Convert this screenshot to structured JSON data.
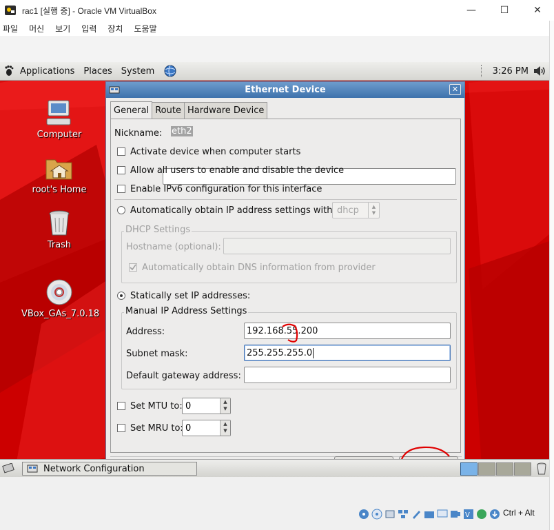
{
  "host_window": {
    "title": "rac1 [실행 중] - Oracle VM VirtualBox",
    "minimize_glyph": "—",
    "maximize_glyph": "☐",
    "close_glyph": "✕",
    "menu": [
      "파일",
      "머신",
      "보기",
      "입력",
      "장치",
      "도움말"
    ]
  },
  "gnome_panel": {
    "menus": [
      "Applications",
      "Places",
      "System"
    ],
    "clock": "3:26 PM"
  },
  "desktop_icons": [
    {
      "label": "Computer",
      "icon": "computer-icon"
    },
    {
      "label": "root's Home",
      "icon": "home-folder-icon"
    },
    {
      "label": "Trash",
      "icon": "trash-icon"
    },
    {
      "label": "VBox_GAs_7.0.18",
      "icon": "cd-icon"
    }
  ],
  "dialog": {
    "title": "Ethernet Device",
    "close_glyph": "✕",
    "tabs": [
      "General",
      "Route",
      "Hardware Device"
    ],
    "active_tab": "General",
    "nickname_label": "Nickname:",
    "nickname_value": "eth2",
    "activate_on_start": "Activate device when computer starts",
    "allow_all_users": "Allow all users to enable and disable the device",
    "enable_ipv6": "Enable IPv6 configuration for this interface",
    "auto_obtain_label": "Automatically obtain IP address settings with:",
    "auto_obtain_method": "dhcp",
    "dhcp_settings_label": "DHCP Settings",
    "hostname_label": "Hostname (optional):",
    "auto_dns_label": "Automatically obtain DNS information from provider",
    "static_label": "Statically set IP addresses:",
    "manual_label": "Manual IP Address Settings",
    "address_label": "Address:",
    "address_value": "192.168.55.200",
    "subnet_label": "Subnet mask:",
    "subnet_value": "255.255.255.0",
    "gateway_label": "Default gateway address:",
    "gateway_value": "",
    "mtu_label": "Set MTU to:",
    "mtu_value": "0",
    "mru_label": "Set MRU to:",
    "mru_value": "0"
  },
  "taskbar": {
    "task_label": "Network Configuration"
  },
  "host_status": {
    "hostkey_label": "Ctrl + Alt"
  },
  "colors": {
    "desktop_red": "#d40000",
    "dialog_title": "#3e72ac",
    "annotation_red": "#e00000"
  }
}
